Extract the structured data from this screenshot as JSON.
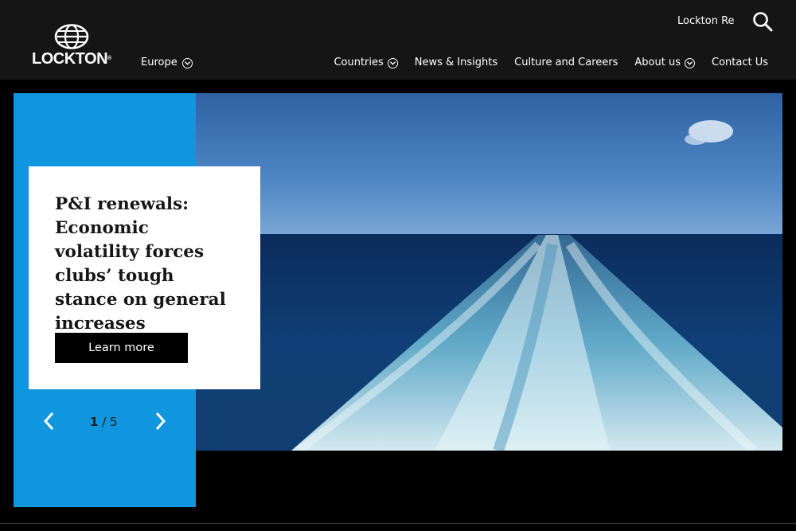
{
  "brand": {
    "name": "LOCKTON",
    "trademark": "®"
  },
  "header": {
    "region": "Europe",
    "top_link": "Lockton Re",
    "nav": [
      {
        "label": "Countries",
        "has_dropdown": true
      },
      {
        "label": "News & Insights",
        "has_dropdown": false
      },
      {
        "label": "Culture and Careers",
        "has_dropdown": false
      },
      {
        "label": "About us",
        "has_dropdown": true
      },
      {
        "label": "Contact Us",
        "has_dropdown": false
      }
    ]
  },
  "hero": {
    "title": "P&I renewals: Economic volatility forces clubs’ tough stance on general increases",
    "cta": "Learn more",
    "current_slide": "1",
    "pager_separator": " / ",
    "total_slides": "5",
    "image": "ocean-ship-wake",
    "colors": {
      "panel": "#0f96de",
      "header": "#151515"
    }
  },
  "icons": {
    "search": "search-icon",
    "prev": "chevron-left-icon",
    "next": "chevron-right-icon",
    "dropdown": "chevron-down-circle-icon"
  }
}
